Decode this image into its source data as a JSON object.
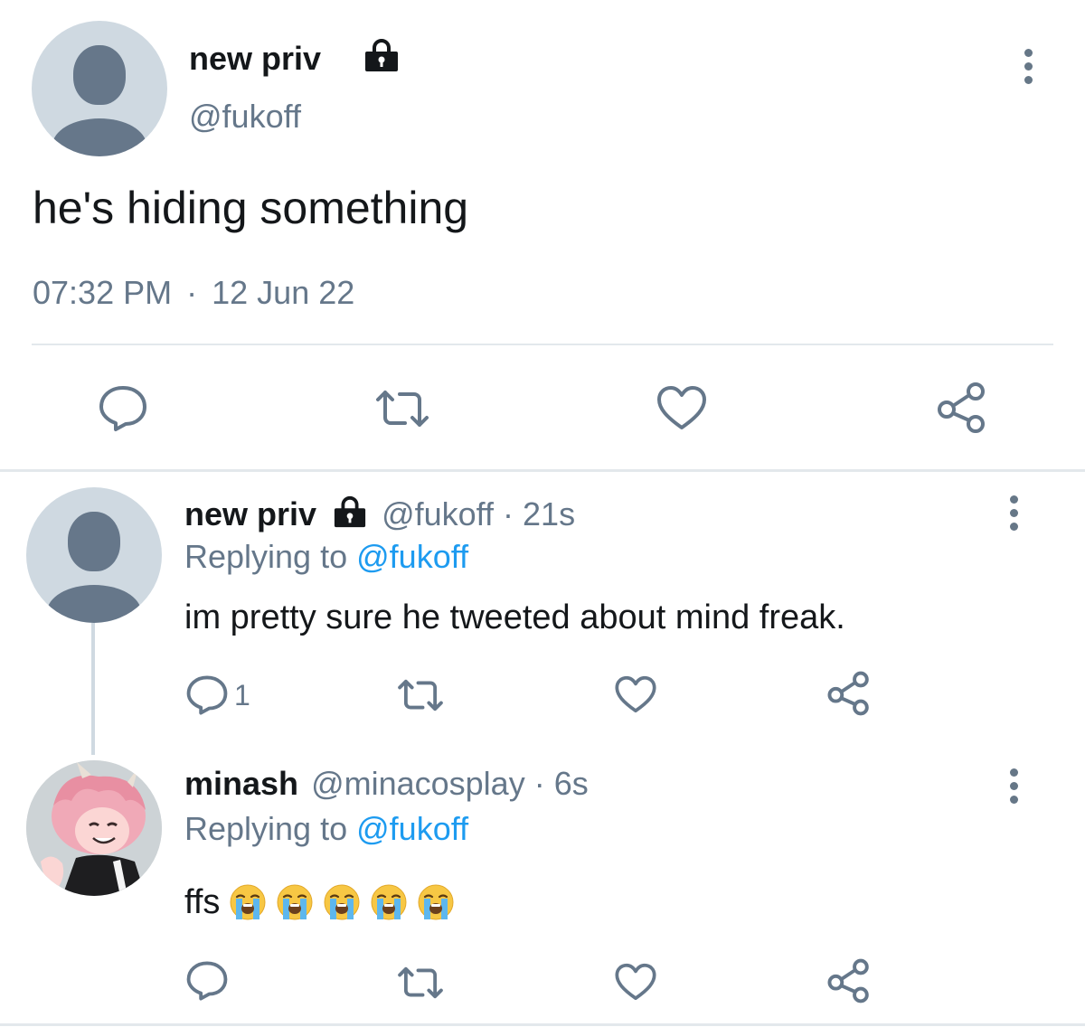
{
  "main_tweet": {
    "display_name": "new priv",
    "handle": "@fukoff",
    "text": "he's hiding something",
    "time": "07:32 PM",
    "separator": "·",
    "date": "12 Jun 22",
    "lock_icon": "lock-icon",
    "more_icon": "more-vertical-icon"
  },
  "replies": [
    {
      "display_name": "new priv",
      "handle": "@fukoff",
      "meta": "· 21s",
      "replying_prefix": "Replying to",
      "replying_to": "@fukoff",
      "text": "im pretty sure he tweeted about mind freak.",
      "reply_count": "1"
    },
    {
      "display_name": "minash",
      "handle": "@minacosplay",
      "meta": "· 6s",
      "replying_prefix": "Replying to",
      "replying_to": "@fukoff",
      "text": "ffs",
      "emojis": [
        "😭",
        "😭",
        "😭",
        "😭",
        "😭"
      ]
    }
  ],
  "colors": {
    "link_blue": "#1d9bf0",
    "secondary_gray": "#65778a",
    "avatar_bg": "#cfd9e1",
    "divider": "#e3e8ec"
  }
}
